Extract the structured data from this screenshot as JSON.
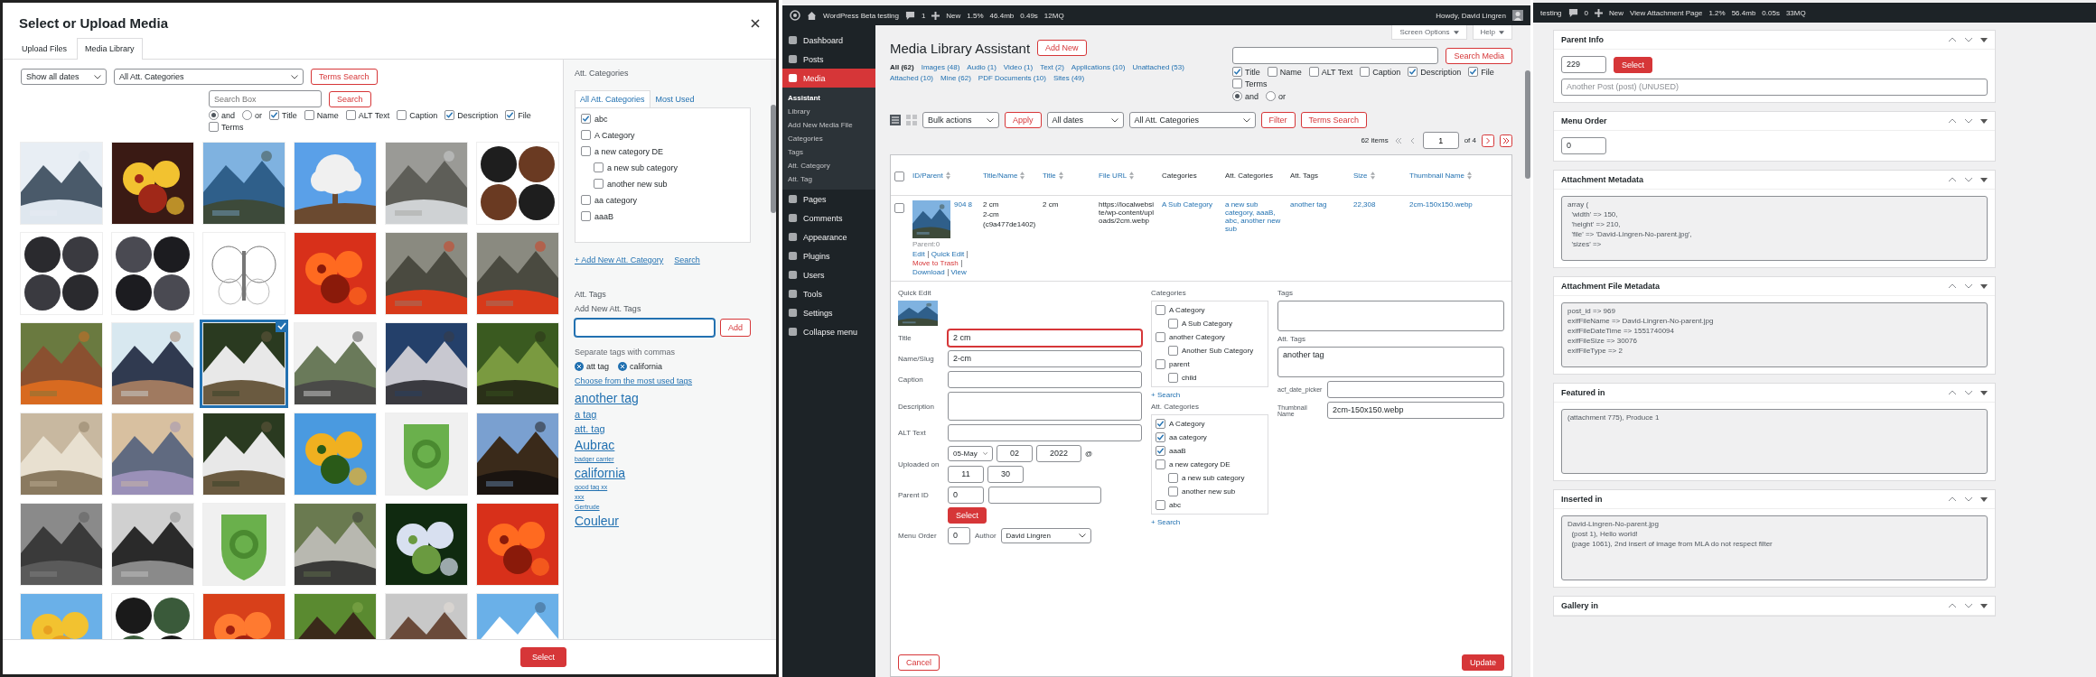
{
  "media_modal": {
    "title": "Select or Upload Media",
    "tabs": [
      {
        "label": "Upload Files",
        "selected": false
      },
      {
        "label": "Media Library",
        "selected": true
      }
    ],
    "date_filter": "Show all dates",
    "category_filter": "All Att. Categories",
    "terms_search_button": "Terms Search",
    "search": {
      "placeholder": "Search Box",
      "button": "Search"
    },
    "match_modes": [
      {
        "label": "and",
        "selected": true
      },
      {
        "label": "or",
        "selected": false
      }
    ],
    "search_fields": [
      {
        "label": "Title",
        "checked": true
      },
      {
        "label": "Name",
        "checked": false
      },
      {
        "label": "ALT Text",
        "checked": false
      },
      {
        "label": "Caption",
        "checked": false
      },
      {
        "label": "Description",
        "checked": true
      },
      {
        "label": "File",
        "checked": true
      },
      {
        "label": "Terms",
        "checked": false
      }
    ],
    "thumbnails": [
      {
        "kind": "picture",
        "selected": false
      },
      {
        "kind": "picture",
        "selected": false
      },
      {
        "kind": "picture",
        "selected": false
      },
      {
        "kind": "picture",
        "selected": false
      },
      {
        "kind": "picture",
        "selected": false
      },
      {
        "kind": "picture",
        "selected": false
      },
      {
        "kind": "picture",
        "selected": false
      },
      {
        "kind": "picture",
        "selected": false
      },
      {
        "kind": "picture",
        "selected": false
      },
      {
        "kind": "picture",
        "selected": false
      },
      {
        "kind": "picture",
        "selected": false
      },
      {
        "kind": "picture",
        "selected": false
      },
      {
        "kind": "picture",
        "selected": false
      },
      {
        "kind": "picture",
        "selected": false
      },
      {
        "kind": "picture",
        "selected": true
      },
      {
        "kind": "picture",
        "selected": false
      },
      {
        "kind": "picture",
        "selected": false
      },
      {
        "kind": "picture",
        "selected": false
      },
      {
        "kind": "picture",
        "selected": false
      },
      {
        "kind": "picture",
        "selected": false
      },
      {
        "kind": "picture",
        "selected": false
      },
      {
        "kind": "picture",
        "selected": false
      },
      {
        "kind": "picture",
        "selected": false
      },
      {
        "kind": "picture",
        "selected": false
      },
      {
        "kind": "picture",
        "selected": false
      },
      {
        "kind": "picture",
        "selected": false
      },
      {
        "kind": "picture",
        "selected": false
      },
      {
        "kind": "picture",
        "selected": false
      },
      {
        "kind": "picture",
        "selected": false
      },
      {
        "kind": "picture",
        "selected": false
      },
      {
        "kind": "picture",
        "selected": false
      },
      {
        "kind": "picture",
        "selected": false
      },
      {
        "kind": "picture",
        "selected": false
      },
      {
        "kind": "picture",
        "selected": false
      },
      {
        "kind": "picture",
        "selected": false
      },
      {
        "kind": "picture",
        "selected": false
      }
    ],
    "sidebar": {
      "heading": "Att. Categories",
      "tabs": [
        {
          "label": "All Att. Categories",
          "selected": true
        },
        {
          "label": "Most Used",
          "selected": false
        }
      ],
      "categories": [
        {
          "label": "abc",
          "checked": true
        },
        {
          "label": "A Category",
          "checked": false
        },
        {
          "label": "a new category DE",
          "checked": false,
          "children": [
            {
              "label": "a new sub category",
              "checked": false
            },
            {
              "label": "another new sub",
              "checked": false
            }
          ]
        },
        {
          "label": "aa category",
          "checked": false
        },
        {
          "label": "aaaB",
          "checked": false
        }
      ],
      "add_link": "+ Add New Att. Category",
      "search_link": "Search",
      "tags_heading": "Att. Tags",
      "add_tags_label": "Add New Att. Tags",
      "add_button": "Add",
      "hint": "Separate tags with commas",
      "current_tags": [
        "att tag",
        "california"
      ],
      "most_used_link": "Choose from the most used tags",
      "tag_cloud": [
        {
          "label": "another tag",
          "kind": "large"
        },
        {
          "label": "a tag",
          "kind": "medium"
        },
        {
          "label": "att. tag",
          "kind": "medium"
        },
        {
          "label": "Aubrac",
          "kind": "large"
        },
        {
          "label": "badger carrier",
          "kind": "small"
        },
        {
          "label": "california",
          "kind": "large"
        },
        {
          "label": "good tag xx",
          "kind": "small"
        },
        {
          "label": "xxx",
          "kind": "small"
        },
        {
          "label": "Gertrude",
          "kind": "small"
        },
        {
          "label": "Couleur",
          "kind": "large"
        }
      ]
    },
    "select_button": "Select"
  },
  "admin": {
    "toolbar": {
      "site": "WordPress Beta testing",
      "comments": "1",
      "new": "New",
      "stats": [
        "1.5%",
        "46.4mb",
        "0.49s",
        "12MQ"
      ],
      "howdy": "Howdy, David Lingren"
    },
    "menu": [
      {
        "label": "Dashboard",
        "selected": false
      },
      {
        "label": "Posts",
        "selected": false
      },
      {
        "label": "Media",
        "selected": true,
        "children": [
          {
            "label": "Assistant",
            "selected": true
          },
          {
            "label": "Library",
            "selected": false
          },
          {
            "label": "Add New Media File",
            "selected": false
          },
          {
            "label": "Categories",
            "selected": false
          },
          {
            "label": "Tags",
            "selected": false
          },
          {
            "label": "Att. Category",
            "selected": false
          },
          {
            "label": "Att. Tag",
            "selected": false
          }
        ]
      },
      {
        "label": "Pages",
        "selected": false
      },
      {
        "label": "Comments",
        "selected": false
      },
      {
        "label": "Appearance",
        "selected": false
      },
      {
        "label": "Plugins",
        "selected": false
      },
      {
        "label": "Users",
        "selected": false
      },
      {
        "label": "Tools",
        "selected": false
      },
      {
        "label": "Settings",
        "selected": false
      },
      {
        "label": "Collapse menu",
        "selected": false
      }
    ],
    "screen_options": "Screen Options",
    "help": "Help",
    "page_title": "Media Library Assistant",
    "add_new": "Add New",
    "filters": [
      {
        "label": "All (62)",
        "selected": true
      },
      {
        "label": "Images (48)",
        "selected": false
      },
      {
        "label": "Audio (1)",
        "selected": false
      },
      {
        "label": "Video (1)",
        "selected": false
      },
      {
        "label": "Text (2)",
        "selected": false
      },
      {
        "label": "Applications (10)",
        "selected": false
      },
      {
        "label": "Unattached (53)",
        "selected": false
      },
      {
        "label": "Attached (10)",
        "selected": false
      },
      {
        "label": "Mine (62)",
        "selected": false
      },
      {
        "label": "PDF Documents (10)",
        "selected": false
      },
      {
        "label": "Sites (49)",
        "selected": false
      }
    ],
    "search_button": "Search Media",
    "search_fields": [
      {
        "label": "Title",
        "checked": true
      },
      {
        "label": "Name",
        "checked": false
      },
      {
        "label": "ALT Text",
        "checked": false
      },
      {
        "label": "Caption",
        "checked": false
      },
      {
        "label": "Description",
        "checked": true
      },
      {
        "label": "File",
        "checked": true
      },
      {
        "label": "Terms",
        "checked": false
      }
    ],
    "match_modes": [
      {
        "label": "and",
        "selected": true
      },
      {
        "label": "or",
        "selected": false
      }
    ],
    "bulk_actions": "Bulk actions",
    "apply": "Apply",
    "date_filter": "All dates",
    "category_filter": "All Att. Categories",
    "filter": "Filter",
    "terms_search": "Terms Search",
    "select_all_checked": false,
    "items_count": "62 items",
    "page": "1",
    "page_of": "of 4",
    "columns": [
      {
        "label": "ID/Parent",
        "sortable": true
      },
      {
        "label": "Title/Name",
        "sortable": true
      },
      {
        "label": "Title",
        "sortable": true
      },
      {
        "label": "File URL",
        "sortable": true
      },
      {
        "label": "Categories",
        "sortable": false
      },
      {
        "label": "Att. Categories",
        "sortable": false
      },
      {
        "label": "Att. Tags",
        "sortable": false
      },
      {
        "label": "Size",
        "sortable": true
      },
      {
        "label": "Thumbnail Name",
        "sortable": true
      }
    ],
    "row": {
      "checked": false,
      "id": "904 8",
      "parent": "Parent:0",
      "actions": [
        "Edit",
        "Quick Edit",
        "Move to Trash",
        "Download",
        "View"
      ],
      "title_name": [
        "2 cm",
        "2-cm",
        "(c9a477de1402)"
      ],
      "title": "2 cm",
      "file_url": "https://localwebsite/wp-content/uploads/2cm.webp",
      "categories": "A Sub Category",
      "att_categories": "a new sub category, aaaB, abc, another new sub",
      "att_tags": "another tag",
      "size": "22,308",
      "thumbnail_name": "2cm-150x150.webp"
    },
    "quick_edit": {
      "heading": "Quick Edit",
      "fields": [
        {
          "label": "Title",
          "value": "2 cm",
          "invalid": true
        },
        {
          "label": "Name/Slug",
          "value": "2-cm",
          "invalid": false
        },
        {
          "label": "Caption",
          "invalid": false
        },
        {
          "label": "Description",
          "invalid": false,
          "kind": "textarea"
        },
        {
          "label": "ALT Text",
          "invalid": false
        }
      ],
      "uploaded_label": "Uploaded on",
      "month": "05-May",
      "day": "02",
      "year": "2022",
      "at": "@",
      "hour": "11",
      "minute": "30",
      "parent_label": "Parent ID",
      "parent_value": "0",
      "select_button": "Select",
      "menu_order_label": "Menu Order",
      "menu_order_value": "0",
      "author_label": "Author",
      "author": "David Lingren",
      "categories_heading": "Categories",
      "categories": [
        {
          "label": "A Category",
          "checked": false,
          "children": [
            {
              "label": "A Sub Category",
              "checked": false
            }
          ]
        },
        {
          "label": "another Category",
          "checked": false,
          "children": [
            {
              "label": "Another Sub Category",
              "checked": false
            }
          ]
        },
        {
          "label": "parent",
          "checked": false,
          "children": [
            {
              "label": "child",
              "checked": false
            }
          ]
        }
      ],
      "search_link": "+ Search",
      "att_categories_heading": "Att. Categories",
      "att_categories": [
        {
          "label": "A Category",
          "checked": true
        },
        {
          "label": "aa category",
          "checked": true
        },
        {
          "label": "aaaB",
          "checked": true
        },
        {
          "label": "a new category DE",
          "checked": false,
          "children": [
            {
              "label": "a new sub category",
              "checked": false
            },
            {
              "label": "another new sub",
              "checked": false
            }
          ]
        },
        {
          "label": "abc",
          "checked": false
        }
      ],
      "att_search_link": "+ Search",
      "tags_label": "Tags",
      "att_tags_label": "Att. Tags",
      "att_tags_value": "another tag",
      "acf_label": "acf_date_picker",
      "thumbnail_label": "Thumbnail Name",
      "thumbnail_value": "2cm-150x150.webp",
      "cancel": "Cancel",
      "update": "Update"
    }
  },
  "attachment_page": {
    "toolbar": {
      "site": "testing",
      "comments": "0",
      "new": "New",
      "view": "View Attachment Page",
      "stats": [
        "1.2%",
        "56.4mb",
        "0.05s",
        "33MQ"
      ]
    },
    "boxes": [
      {
        "kind": "parent",
        "title": "Parent Info",
        "parent_id": "229",
        "button": "Select",
        "parent_title": "Another Post (post) (UNUSED)"
      },
      {
        "kind": "order",
        "title": "Menu Order",
        "value": "0"
      },
      {
        "kind": "text",
        "title": "Attachment Metadata",
        "lines": [
          "array (",
          "  'width' => 150,",
          "  'height' => 210,",
          "  'file' => 'David-Lingren-No-parent.jpg',",
          "  'sizes' => "
        ]
      },
      {
        "kind": "text",
        "title": "Attachment File Metadata",
        "lines": [
          "post_id => 969",
          "exifFileName => David-Lingren-No-parent.jpg",
          "exifFileDateTime => 1551740094",
          "exifFileSize => 30076",
          "exifFileType => 2"
        ]
      },
      {
        "kind": "text",
        "title": "Featured in",
        "lines": [
          "(attachment 775), Produce 1"
        ]
      },
      {
        "kind": "text",
        "title": "Inserted in",
        "lines": [
          "David-Lingren-No-parent.jpg",
          "  (post 1), Hello world!",
          "  (page 1061), 2nd insert of image from MLA do not respect filter"
        ]
      },
      {
        "kind": "collapsed",
        "title": "Gallery in"
      }
    ]
  }
}
